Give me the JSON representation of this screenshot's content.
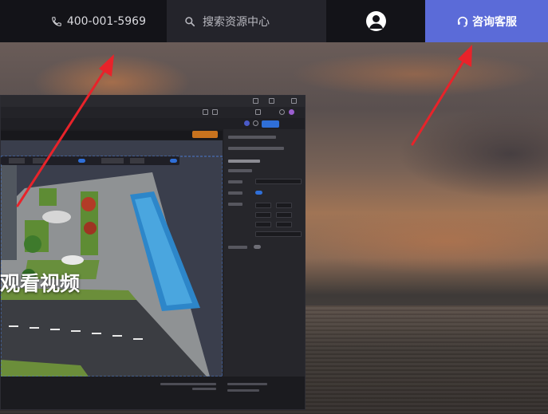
{
  "topbar": {
    "phone": "400-001-5969",
    "search_placeholder": "搜索资源中心",
    "consult_label": "咨询客服"
  },
  "overlay": {
    "watch_text": "观看视频"
  },
  "icons": {
    "phone": "phone-icon",
    "search": "search-icon",
    "user": "user-avatar-icon",
    "headset": "headset-icon",
    "arrow": "red-arrow-annotation"
  },
  "colors": {
    "topbar_bg": "#131318",
    "search_bg": "#24242b",
    "consult_bg": "#5b6bd8",
    "arrow": "#e8232a",
    "accent_blue": "#2f6fd8"
  }
}
